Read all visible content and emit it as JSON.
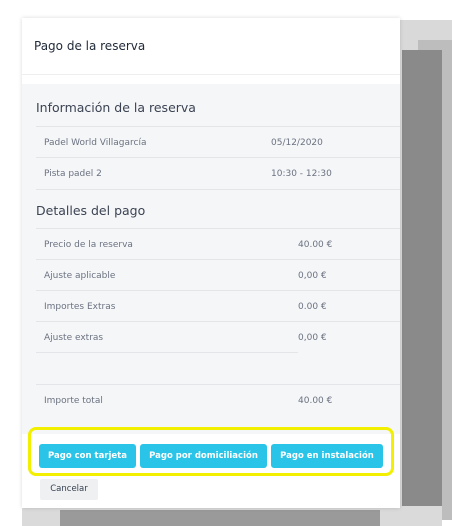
{
  "modal": {
    "title": "Pago de la reserva"
  },
  "reservation_info": {
    "heading": "Información de la reserva",
    "rows": [
      {
        "label": "Padel World Villagarcía",
        "value": "05/12/2020"
      },
      {
        "label": "Pista padel 2",
        "value": "10:30 - 12:30"
      }
    ]
  },
  "payment_details": {
    "heading": "Detalles del pago",
    "rows": [
      {
        "label": "Precio de la reserva",
        "value": "40.00 €"
      },
      {
        "label": "Ajuste aplicable",
        "value": "0,00 €"
      },
      {
        "label": "Importes Extras",
        "value": "0.00 €"
      },
      {
        "label": "Ajuste extras",
        "value": "0,00 €"
      },
      {
        "label": "Importe total",
        "value": "40.00 €"
      }
    ]
  },
  "actions": {
    "card": "Pago con tarjeta",
    "direct_debit": "Pago por domiciliación",
    "on_site": "Pago en instalación",
    "cancel": "Cancelar"
  },
  "colors": {
    "primary_button": "#29c4e8",
    "highlight": "#f2ef00"
  }
}
